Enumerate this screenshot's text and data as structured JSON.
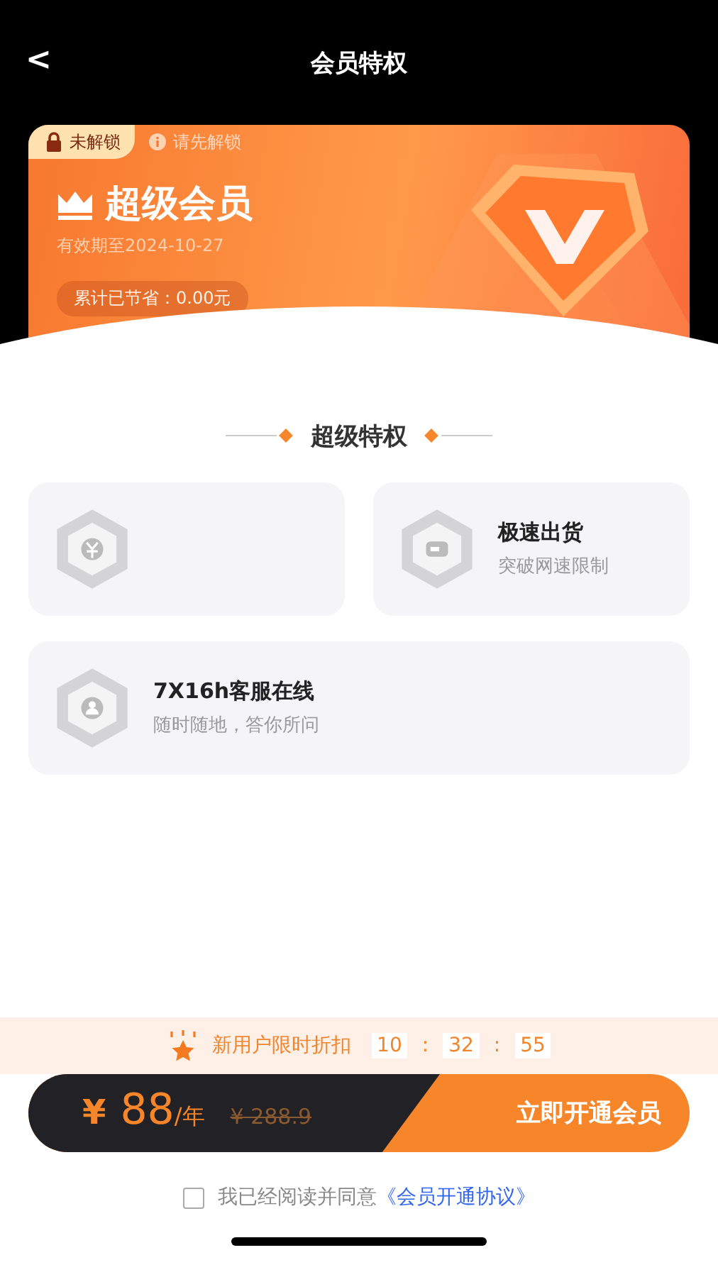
{
  "nav": {
    "back": "<",
    "title": "会员特权"
  },
  "card": {
    "lock_badge": "未解锁",
    "hint": "请先解锁",
    "title": "超级会员",
    "validity": "有效期至2024-10-27",
    "savings": "累计已节省：0.00元"
  },
  "section_title": "超级特权",
  "privileges": [
    {
      "kind": "half"
    },
    {
      "kind": "half",
      "title": "极速出货",
      "subtitle": "突破网速限制"
    },
    {
      "kind": "wide",
      "title": "7X16h客服在线",
      "subtitle": "随时随地，答你所问"
    }
  ],
  "promo": {
    "label": "新用户限时折扣",
    "countdown": [
      "10",
      "32",
      "55"
    ],
    "separator": ":"
  },
  "purchase": {
    "currency": "¥",
    "price": "88",
    "unit": "/年",
    "original_price": "¥ 288.9",
    "button": "立即开通会员"
  },
  "agreement": {
    "checked": false,
    "text": "我已经阅读并同意",
    "link": "《会员开通协议》"
  }
}
